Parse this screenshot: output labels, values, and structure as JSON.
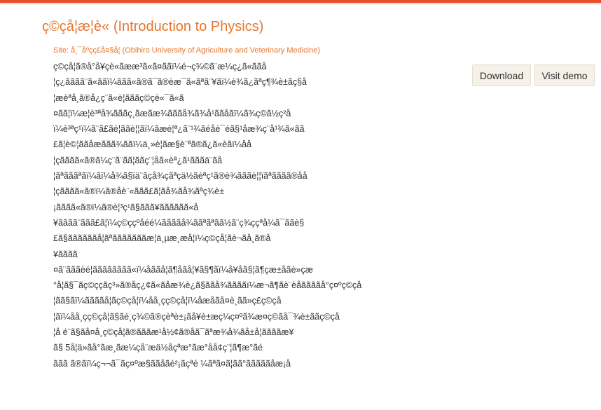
{
  "header": {
    "course_title": "ç©çå¦æ¦è« (Introduction to Physics)",
    "site_line": "Site: å¸¯åºçç£å¤§å¦ (Obihiro University of Agriculture and Veterinary Medicine)"
  },
  "actions": {
    "download_label": "Download",
    "visit_demo_label": "Visit demo"
  },
  "description_lines": [
    "ç©çå¦ã®å°å¥çè«ãææ³ã«ã¤ããï¼é¬ç¾©ã¨æ¼ç¿ã«ããå­",
    "¦ç¿ãããã¨ã«ããï¼ããã«ã®ã¯ã®èæ¯ã«ãªã¨¥ãï¼è¾ã¿ãªç¶¾è±ãç§å",
    "¦æèªå¸ã®å¿ç¨ã«è¦ãããç©çè«¯ã«ã",
    "¤ãã¦ï¼æ¦è³ªå¾ãããç¸ãæãæ¾ãããå¾ã¾å¹ããåãï¼ã¾ç©ã½ç²å",
    "ï¼è³ªç¹ï¼ã¨ã£ãè¦ããè¦¦ãï¼ãæè¦ª¿ã¨¹¾ãéåè¯é­ã§¹åæ¾ç¨å¹¾ã«ãã",
    "£ã¦è©¦ããåæããã¾ããï¼ä¸»è¦ãæ§è¨ªã®ã¿ã«èãï¼åå­",
    "¦çãããã«ã®ã¼ç¨ã¨ãã¦ããç¨¦åã«èª¿ã¹ãããä¨ãå­",
    "¦ãªãããªãï¼ãï¼å¾ã§ïä¨ãçå¾çãªçä½ãèªç¹ã®è¾ãããè¦¦ïãªãããã®åå­",
    "¦çãããã«ã®ï¼ã®åè¨«ããã£ã¦ãå¾ãå¾ãªç¾è±",
    "¡ãããã«ã®ï¼ã®è¦³ç¹ã§ããã¥ãããããã«å",
    "¥ãããã¨ããã£ã¦ï¼ç©ççºåéé¼ããããå¾ããªãªãã½ã¨ç¾ççªå¼ã¯ããè§",
    "£ã§ããããããå¦ãªãããããããæ¦ä¸µæ¸æå¦ï¼ç©çå¦ãè¬ãå¸ã®å",
    "¥ãããã",
    "¤ã¨ãããèé¦ãããããããã«ï¼åããå¦ã¶åãå¦¥ã§¶ãï¼å¥åã§¦ã¶çæ±åãè»çæ",
    "°å¦ã§¯ãç©ççãç³»ã®åç¿¢ã«ãåæ¾è¿ã§ããå¾ããããï¼æ¬ã¶ãè¨èåããããå°ç¤ºç©çå",
    "¦ãã§ãï¼ããããå¦ãç©çå¦ï¼åå¸çç©çå¦ï¼åæåãå¤è¸ãã»ç£ç©çå",
    "¦ãï¼åå¸çç©çå¦ã§ãé¸ç¾©ã®çèªè±¡ãå¥è±æç¼ç¤ºã¾æ¤ç©ãå¯¾è±ããç©çå",
    "¦å é¨ã§ãå¤å¸ç©çå¦ã®ãããæ¹å½¢ã®åã¯ãªæ¾å¾ãå±å¦ããããæ¥­",
    "ã§ 5å¦ä»ãå°ãæ¸ãæ¼çå¨æä½åçªæ°ãæ°åå¢ç¨¦ã¶æ°ãé",
    "ããã ã®ãï¼ç¬¬ã¯ãç¤ºæ§ããåãè²¡ãçªé ¼ãªã¤ã¦ãã°ãããããåæ¡å"
  ]
}
